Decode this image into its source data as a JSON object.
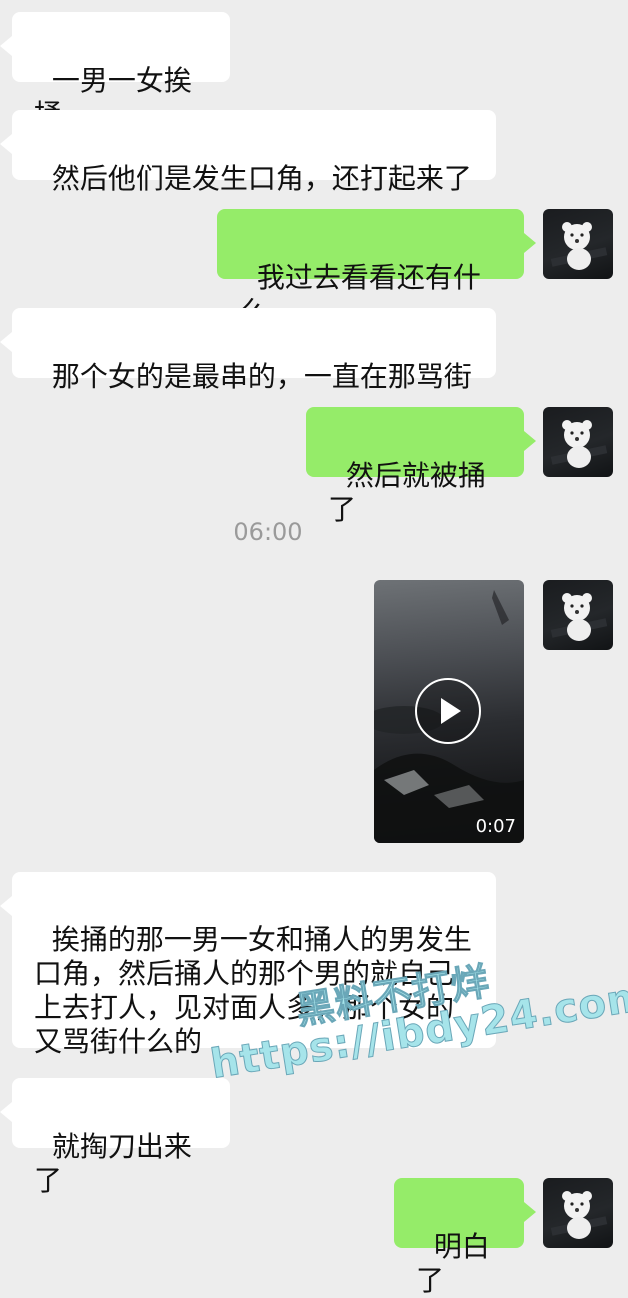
{
  "messages": [
    {
      "side": "incoming",
      "text": "一男一女挨捅"
    },
    {
      "side": "incoming",
      "text": "然后他们是发生口角，还打起来了"
    },
    {
      "side": "outgoing",
      "text": "我过去看看还有什么"
    },
    {
      "side": "incoming",
      "text": "那个女的是最串的，一直在那骂街"
    },
    {
      "side": "outgoing",
      "text": "然后就被捅了"
    },
    {
      "side": "incoming",
      "text": "挨捅的那一男一女和捅人的男发生\n口角，然后捅人的那个男的就自己\n上去打人，见对面人多，那个女的\n又骂街什么的"
    },
    {
      "side": "incoming",
      "text": "就掏刀出来了"
    },
    {
      "side": "outgoing",
      "text": "明白了"
    }
  ],
  "timestamp": "06:00",
  "video": {
    "duration": "0:07",
    "icon": "play-icon"
  },
  "avatar_icon": "teddy-bear-avatar",
  "watermark": {
    "line1": "黑料不打烊",
    "line2": "https://ibdy24.com"
  },
  "colors": {
    "background": "#ededed",
    "incoming_bubble": "#ffffff",
    "outgoing_bubble": "#95ec69",
    "timestamp_text": "#9a9a9a",
    "watermark": "#a6e4ea"
  }
}
